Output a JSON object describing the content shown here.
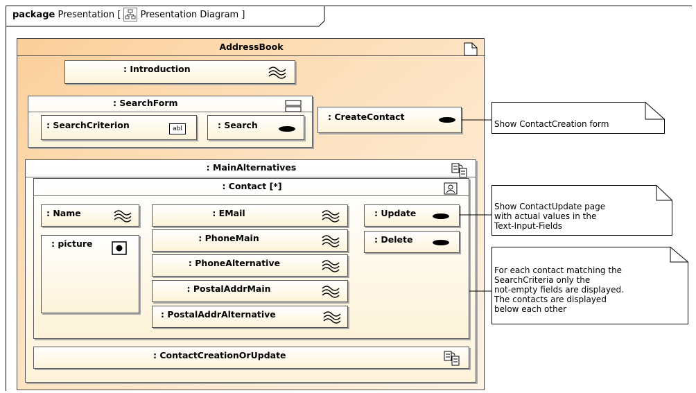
{
  "frame": {
    "keyword": "package",
    "name": "Presentation",
    "diagram_label": "Presentation Diagram"
  },
  "address_book": {
    "title": "AddressBook"
  },
  "introduction": {
    "title": ": Introduction"
  },
  "search_form": {
    "title": ": SearchForm",
    "criterion": ": SearchCriterion",
    "criterion_icon_text": "abl",
    "search": ": Search"
  },
  "create_contact": {
    "title": ": CreateContact"
  },
  "main_alternatives": {
    "title": ": MainAlternatives"
  },
  "contact": {
    "title": ": Contact [*]",
    "name": ": Name",
    "picture": ": picture",
    "fields": [
      ": EMail",
      ": PhoneMain",
      ": PhoneAlternative",
      ": PostalAddrMain",
      ": PostalAddrAlternative"
    ],
    "update": ": Update",
    "delete": ": Delete"
  },
  "contact_creation_or_update": {
    "title": ": ContactCreationOrUpdate"
  },
  "notes": {
    "create": "Show ContactCreation form",
    "update": "Show ContactUpdate page\nwith actual values in the\nText-Input-Fields",
    "display": "For each contact matching the\nSearchCriteria only the\nnot-empty fields are displayed.\nThe contacts are displayed\nbelow each other"
  }
}
